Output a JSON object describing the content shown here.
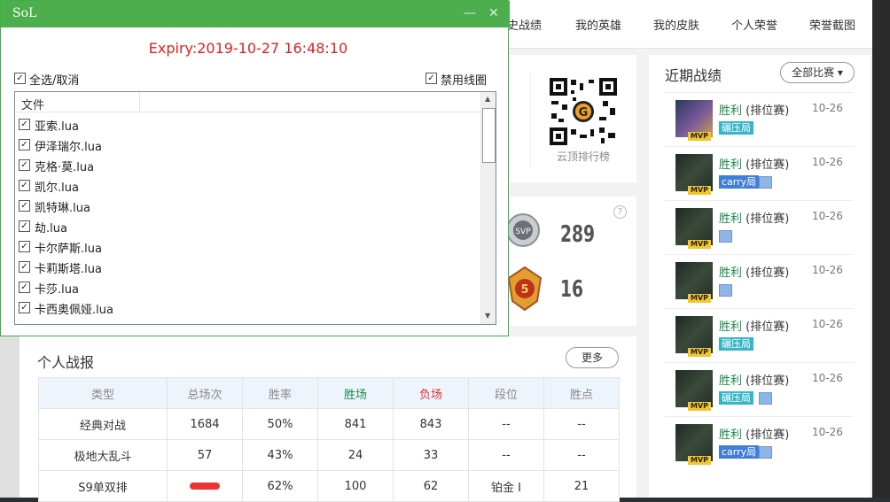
{
  "nav": {
    "items": [
      "史战绩",
      "我的英雄",
      "我的皮肤",
      "个人荣誉",
      "荣誉截图"
    ]
  },
  "qr": {
    "label": "云顶排行榜"
  },
  "badges": {
    "mvp_count": "289",
    "five_count": "16"
  },
  "recent": {
    "title": "近期战绩",
    "filter": "全部比赛 ▾",
    "rows": [
      {
        "result": "胜利",
        "mode": " (排位赛)",
        "date": "10-26",
        "tag": "碾压局",
        "tag_type": "crush",
        "pic": false
      },
      {
        "result": "胜利",
        "mode": " (排位赛)",
        "date": "10-26",
        "tag": "carry局",
        "tag_type": "carry",
        "pic": true
      },
      {
        "result": "胜利",
        "mode": " (排位赛)",
        "date": "10-26",
        "tag": "",
        "tag_type": "",
        "pic": true
      },
      {
        "result": "胜利",
        "mode": " (排位赛)",
        "date": "10-26",
        "tag": "",
        "tag_type": "",
        "pic": true
      },
      {
        "result": "胜利",
        "mode": " (排位赛)",
        "date": "10-26",
        "tag": "碾压局",
        "tag_type": "crush",
        "pic": false
      },
      {
        "result": "胜利",
        "mode": " (排位赛)",
        "date": "10-26",
        "tag": "碾压局",
        "tag_type": "crush",
        "pic": true
      },
      {
        "result": "胜利",
        "mode": " (排位赛)",
        "date": "10-26",
        "tag": "carry局",
        "tag_type": "carry",
        "pic": true
      }
    ]
  },
  "stats": {
    "title": "个人战报",
    "more": "更多",
    "headers": [
      "类型",
      "总场次",
      "胜率",
      "胜场",
      "负场",
      "段位",
      "胜点"
    ],
    "rows": [
      [
        "经典对战",
        "1684",
        "50%",
        "841",
        "843",
        "--",
        "--"
      ],
      [
        "极地大乱斗",
        "57",
        "43%",
        "24",
        "33",
        "--",
        "--"
      ],
      [
        "S9单双排",
        "",
        "62%",
        "100",
        "62",
        "铂金 Ⅰ",
        "21"
      ]
    ]
  },
  "sol": {
    "title": "SoL",
    "min": "—",
    "close": "✕",
    "expiry": "Expiry:2019-10-27 16:48:10",
    "select_all": "全选/取消",
    "disable_ring": "禁用线圈",
    "list_header": "文件",
    "files": [
      "亚索.lua",
      "伊泽瑞尔.lua",
      "克格·莫.lua",
      "凯尔.lua",
      "凯特琳.lua",
      "劫.lua",
      "卡尔萨斯.lua",
      "卡莉斯塔.lua",
      "卡莎.lua",
      "卡西奥佩娅.lua"
    ],
    "check": "✓"
  }
}
